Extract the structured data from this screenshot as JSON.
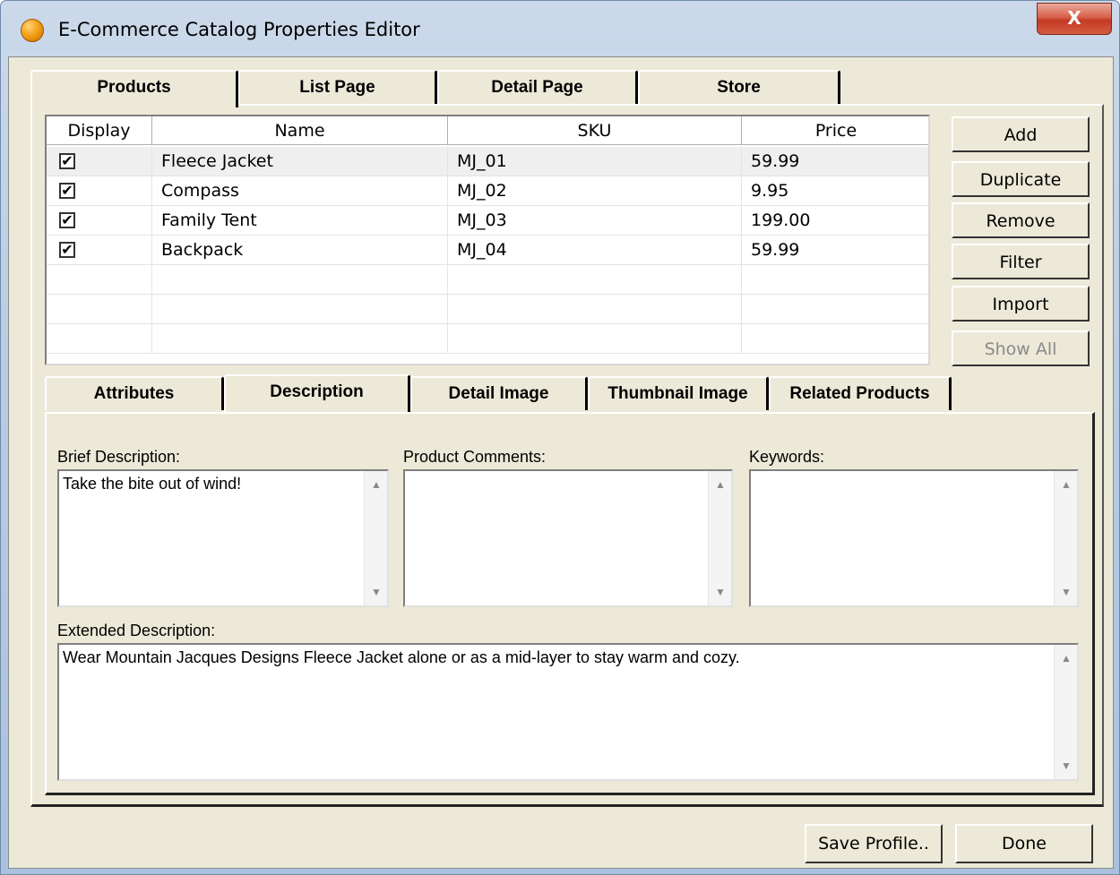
{
  "window": {
    "title": "E-Commerce Catalog Properties Editor",
    "close_label": "X"
  },
  "tabs_top": [
    "Products",
    "List Page",
    "Detail Page",
    "Store"
  ],
  "grid": {
    "columns": [
      "Display",
      "Name",
      "SKU",
      "Price"
    ],
    "rows": [
      {
        "display": true,
        "name": "Fleece Jacket",
        "sku": "MJ_01",
        "price": "59.99"
      },
      {
        "display": true,
        "name": "Compass",
        "sku": "MJ_02",
        "price": "9.95"
      },
      {
        "display": true,
        "name": "Family Tent",
        "sku": "MJ_03",
        "price": "199.00"
      },
      {
        "display": true,
        "name": "Backpack",
        "sku": "MJ_04",
        "price": "59.99"
      }
    ]
  },
  "side_buttons": [
    "Add",
    "Duplicate",
    "Remove",
    "Filter",
    "Import",
    "Show All"
  ],
  "sub_tabs": [
    "Attributes",
    "Description",
    "Detail Image",
    "Thumbnail Image",
    "Related Products"
  ],
  "description": {
    "brief_label": "Brief Description:",
    "brief_value": "Take the bite out of wind!",
    "comments_label": "Product Comments:",
    "comments_value": "",
    "keywords_label": "Keywords:",
    "keywords_value": "",
    "extended_label": "Extended Description:",
    "extended_value": "Wear Mountain Jacques Designs Fleece Jacket alone or as a mid-layer to stay warm and cozy."
  },
  "footer": {
    "save_label": "Save Profile..",
    "done_label": "Done"
  },
  "icons": {
    "checkbox_mark": "✔",
    "scroll_up": "▲",
    "scroll_down": "▼"
  }
}
